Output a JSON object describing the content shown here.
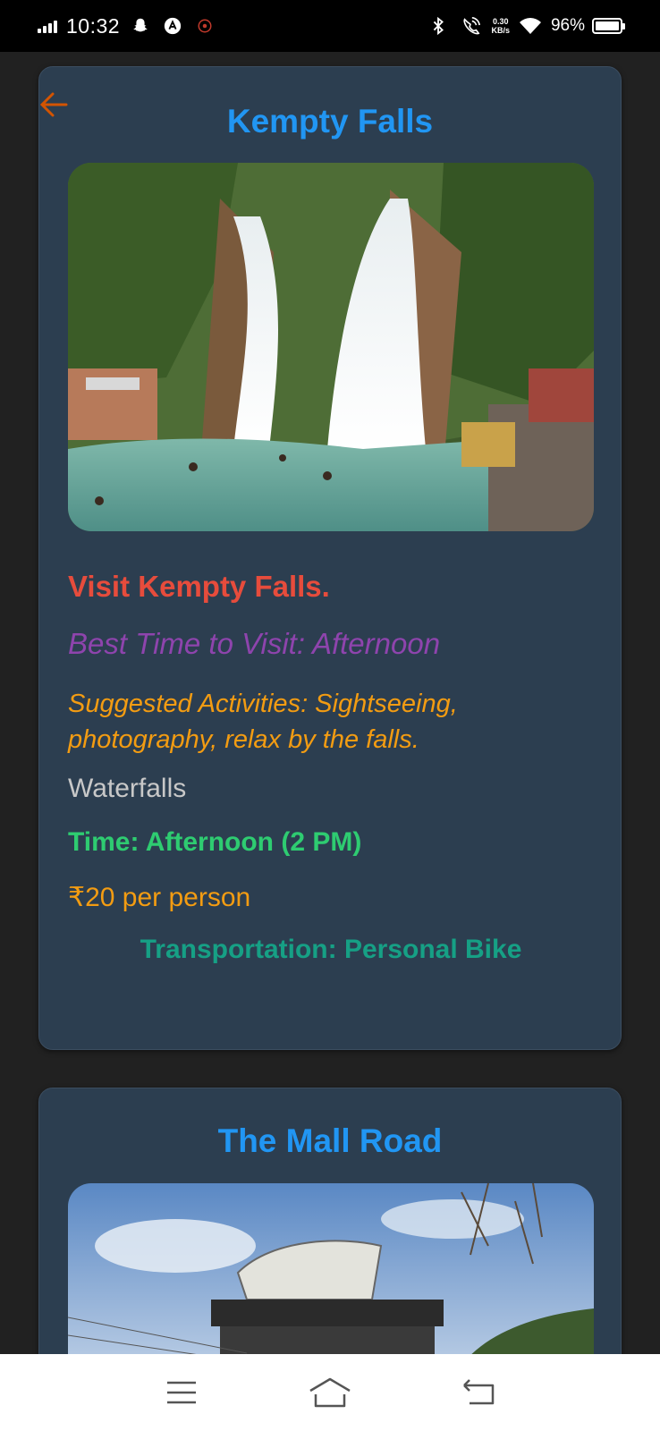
{
  "status_bar": {
    "time": "10:32",
    "net_speed_value": "0.30",
    "net_speed_unit": "KB/s",
    "battery": "96%",
    "icons": [
      "signal-icon",
      "snapchat-icon",
      "app-icon",
      "record-icon",
      "bluetooth-icon",
      "wifi-call-icon",
      "wifi-icon",
      "battery-icon"
    ]
  },
  "places": [
    {
      "title": "Kempty Falls",
      "visit": "Visit Kempty Falls.",
      "best_time": "Best Time to Visit: Afternoon",
      "activities": "Suggested Activities: Sightseeing, photography, relax by the falls.",
      "category": "Waterfalls",
      "time": "Time: Afternoon (2 PM)",
      "price": "₹20 per person",
      "transport": "Transportation: Personal Bike"
    },
    {
      "title": "The Mall Road"
    }
  ],
  "nav_bar": {
    "icons": [
      "menu-icon",
      "home-icon",
      "back-icon"
    ]
  },
  "colors": {
    "title": "#2196f3",
    "visit": "#e74c3c",
    "best_time": "#8e44ad",
    "activities": "#f39c12",
    "time": "#2ecc71",
    "transport": "#16a085",
    "card_bg": "#2c3e50",
    "back_arrow": "#d35400"
  }
}
